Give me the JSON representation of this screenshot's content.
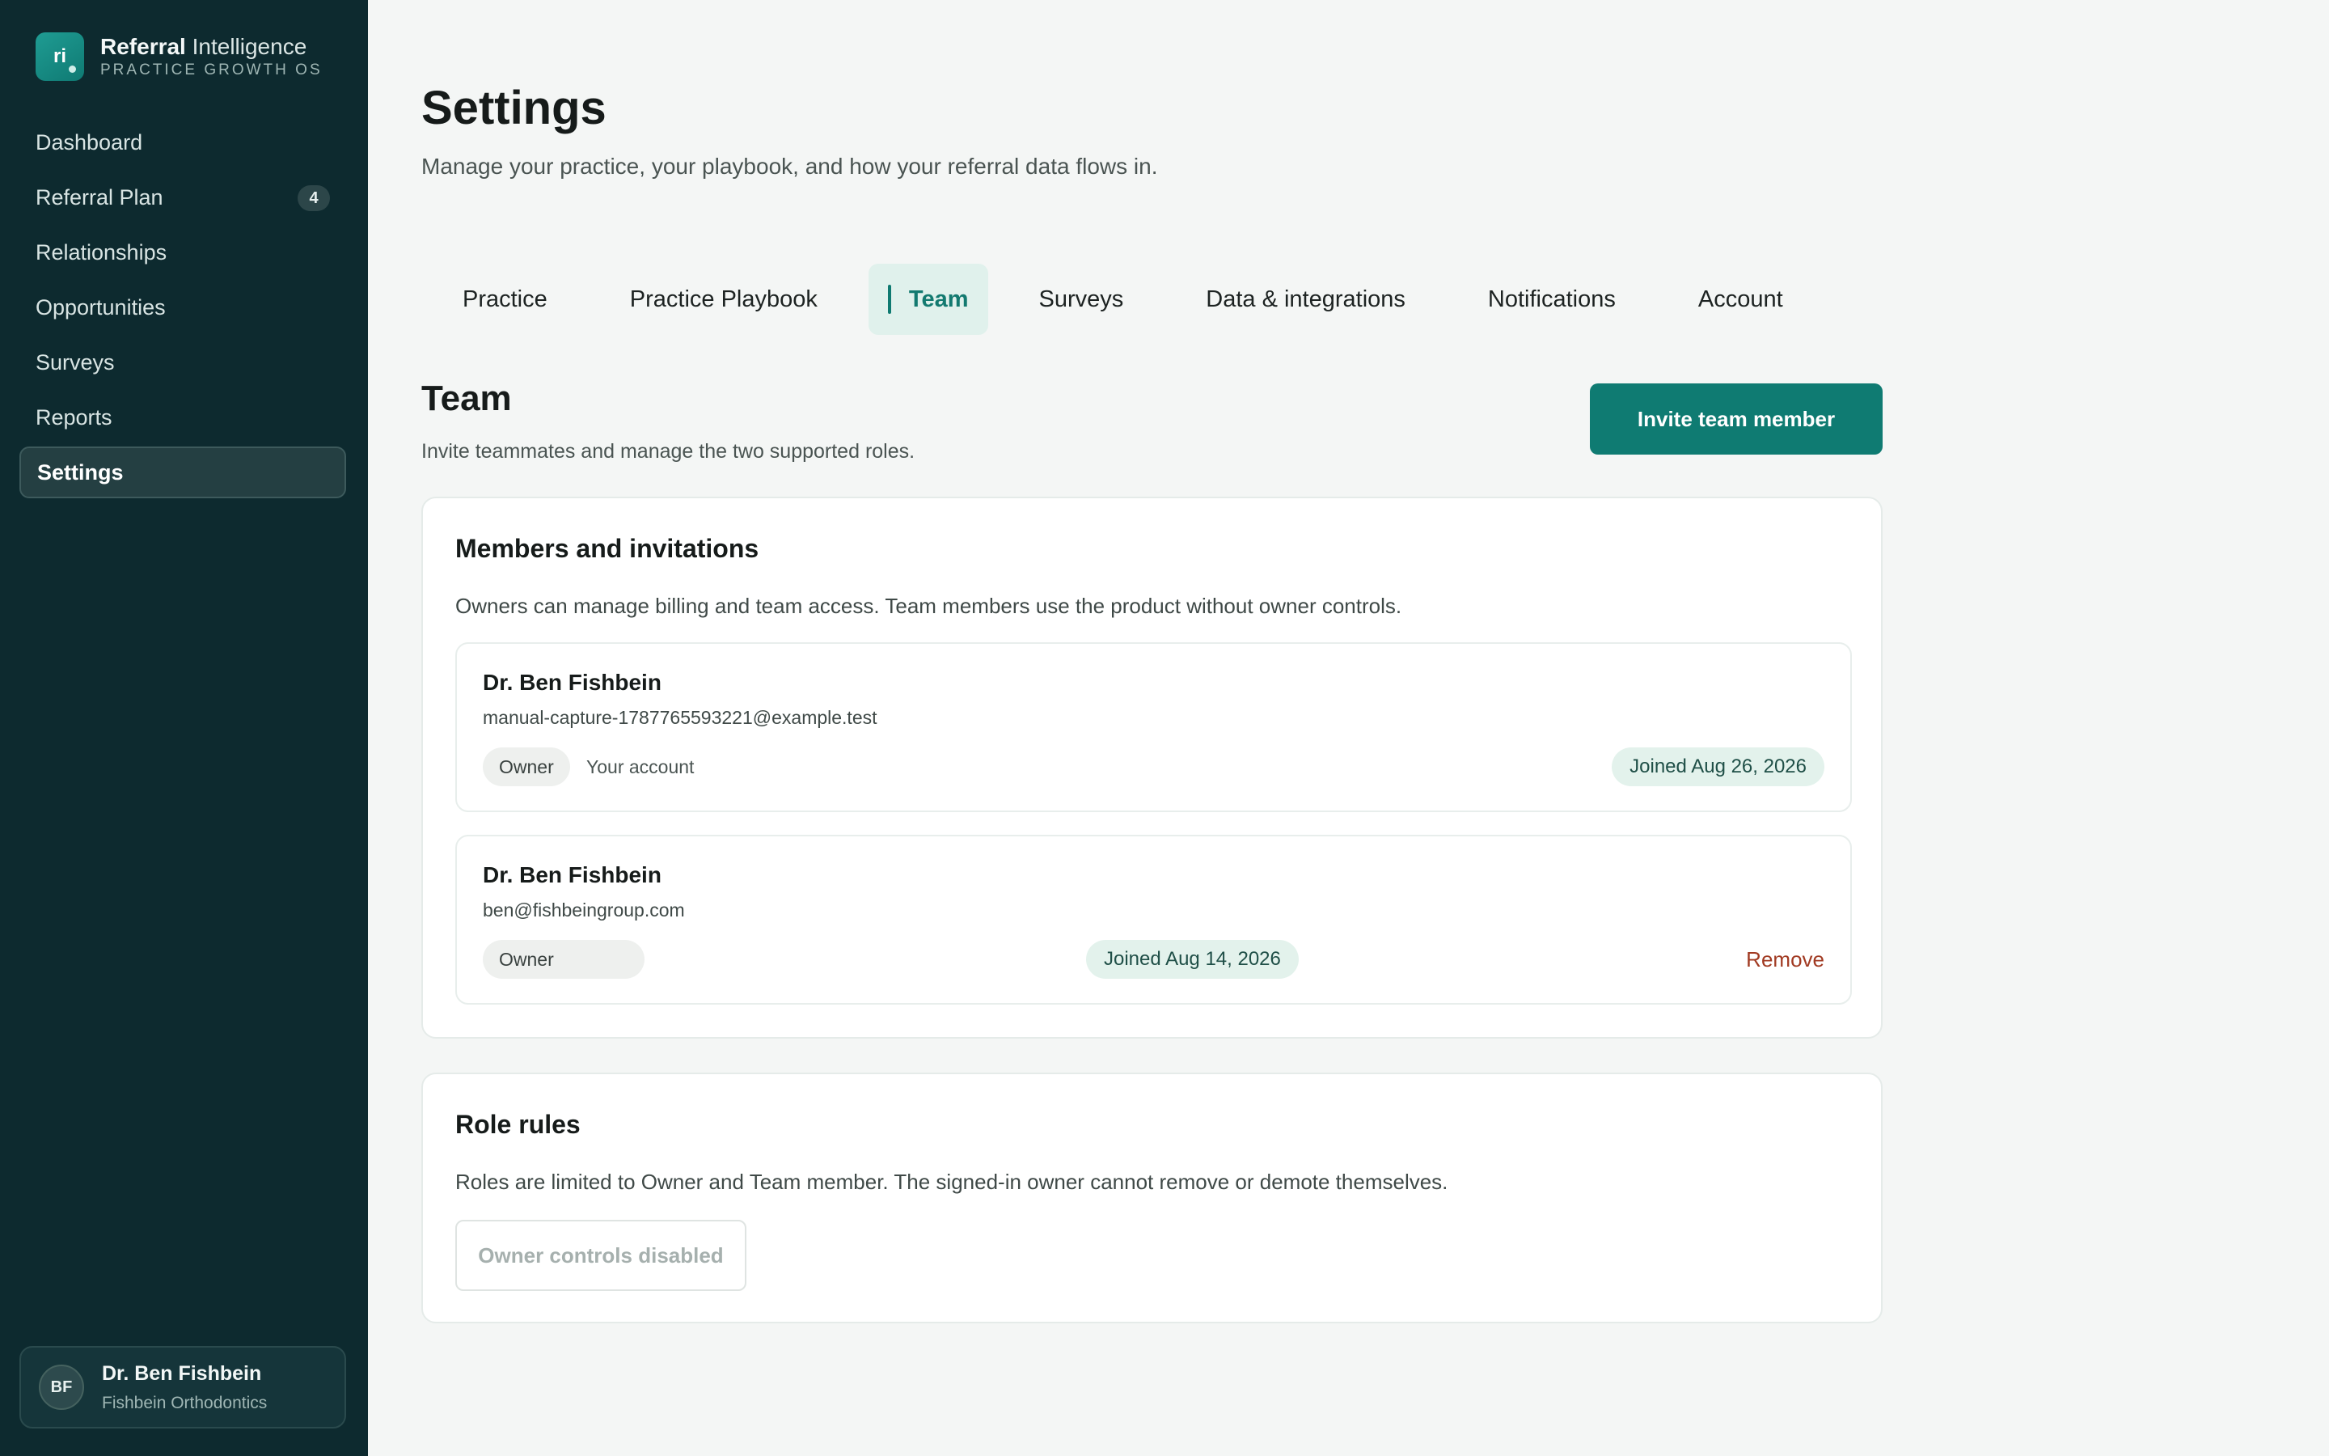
{
  "brand": {
    "logo_text": "ri",
    "name_bold": "Referral",
    "name_rest": " Intelligence",
    "tagline": "PRACTICE GROWTH OS"
  },
  "sidebar": {
    "items": [
      {
        "label": "Dashboard"
      },
      {
        "label": "Referral Plan",
        "badge": "4"
      },
      {
        "label": "Relationships"
      },
      {
        "label": "Opportunities"
      },
      {
        "label": "Surveys"
      },
      {
        "label": "Reports"
      },
      {
        "label": "Settings",
        "active": true
      }
    ]
  },
  "user": {
    "initials": "BF",
    "name": "Dr. Ben Fishbein",
    "org": "Fishbein Orthodontics"
  },
  "page": {
    "title": "Settings",
    "subtitle": "Manage your practice, your playbook, and how your referral data flows in."
  },
  "tabs": [
    {
      "label": "Practice"
    },
    {
      "label": "Practice Playbook"
    },
    {
      "label": "Team",
      "active": true
    },
    {
      "label": "Surveys"
    },
    {
      "label": "Data & integrations"
    },
    {
      "label": "Notifications"
    },
    {
      "label": "Account"
    }
  ],
  "team": {
    "title": "Team",
    "description": "Invite teammates and manage the two supported roles.",
    "invite_label": "Invite team member"
  },
  "members_card": {
    "title": "Members and invitations",
    "description": "Owners can manage billing and team access. Team members use the product without owner controls.",
    "members": [
      {
        "name": "Dr. Ben Fishbein",
        "email": "manual-capture-1787765593221@example.test",
        "role": "Owner",
        "note": "Your account",
        "joined": "Joined Aug 26, 2026"
      },
      {
        "name": "Dr. Ben Fishbein",
        "email": "ben@fishbeingroup.com",
        "role": "Owner",
        "joined": "Joined Aug 14, 2026",
        "action": "Remove"
      }
    ]
  },
  "roles_card": {
    "title": "Role rules",
    "description": "Roles are limited to Owner and Team member. The signed-in owner cannot remove or demote themselves.",
    "button_label": "Owner controls disabled"
  },
  "colors": {
    "sidebar_bg": "#0d2a2f",
    "accent": "#0f7b72",
    "danger": "#a13a22",
    "page_bg": "#f4f6f5"
  }
}
